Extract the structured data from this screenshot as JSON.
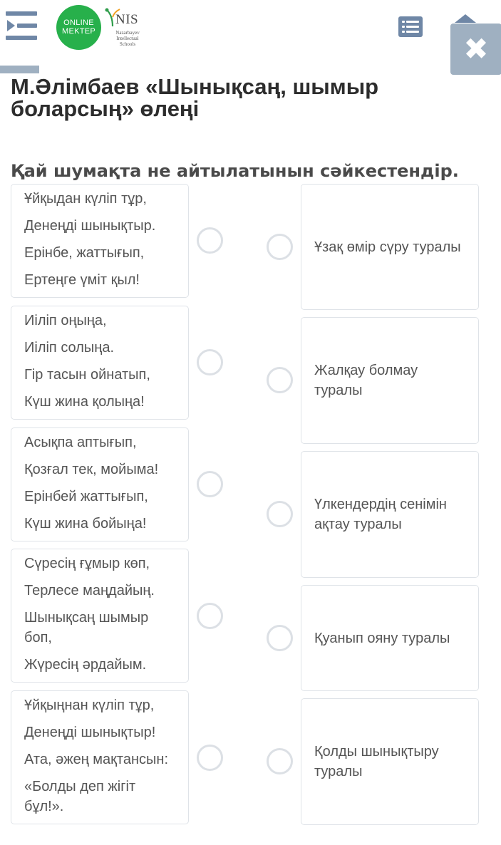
{
  "header": {
    "logo_online": [
      "ONLINE",
      "MEKTEP"
    ],
    "logo_nis_word": "NIS",
    "logo_nis_sub": [
      "Nazarbayev",
      "Intellectual",
      "Schools"
    ]
  },
  "title": "М.Әлімбаев «Шынықсаң, шымыр боларсың» өлеңі",
  "question": "Қай шумақта не айтылатынын сәйкестендір.",
  "stanzas": [
    {
      "lines": [
        "Ұйқыдан күліп тұр,",
        "Денеңді шынықтыр.",
        "Ерінбе, жаттығып,",
        "Ертеңге үміт қыл!"
      ]
    },
    {
      "lines": [
        "Иіліп оңыңа,",
        "Иіліп солыңа.",
        "Гір тасын ойнатып,",
        "Күш жина қолыңа!"
      ]
    },
    {
      "lines": [
        "Асықпа аптығып,",
        "Қозғал тек, мойыма!",
        "Ерінбей жаттығып,",
        "Күш жина бойыңа!"
      ]
    },
    {
      "lines": [
        "Сүресің ғұмыр көп,",
        "Терлесе маңдайың.",
        "Шынықсаң шымыр боп,",
        "Жүресің әрдайым."
      ]
    },
    {
      "lines": [
        "Ұйқыңнан күліп тұр,",
        "Денеңді шынықтыр!",
        "Ата, әжең мақтансын:",
        "«Болды деп жігіт бұл!»."
      ]
    }
  ],
  "answers": [
    {
      "label": "Ұзақ өмір сүру туралы"
    },
    {
      "label": "Жалқау болмау туралы"
    },
    {
      "label": "Үлкендердің сенімін ақтау туралы"
    },
    {
      "label": "Қуанып ояну туралы"
    },
    {
      "label": "Қолды шынықтыру туралы"
    }
  ],
  "colors": {
    "accent": "#6f87a6",
    "close_bg": "#9fb0c1",
    "logo_green": "#27b04b",
    "card_border": "#dfe3e8",
    "radio_border": "#dce0e5"
  },
  "icons": {
    "menu": "menu-collapse-icon",
    "list": "list-icon",
    "close": "close-icon",
    "cap": "graduation-cap-icon"
  }
}
